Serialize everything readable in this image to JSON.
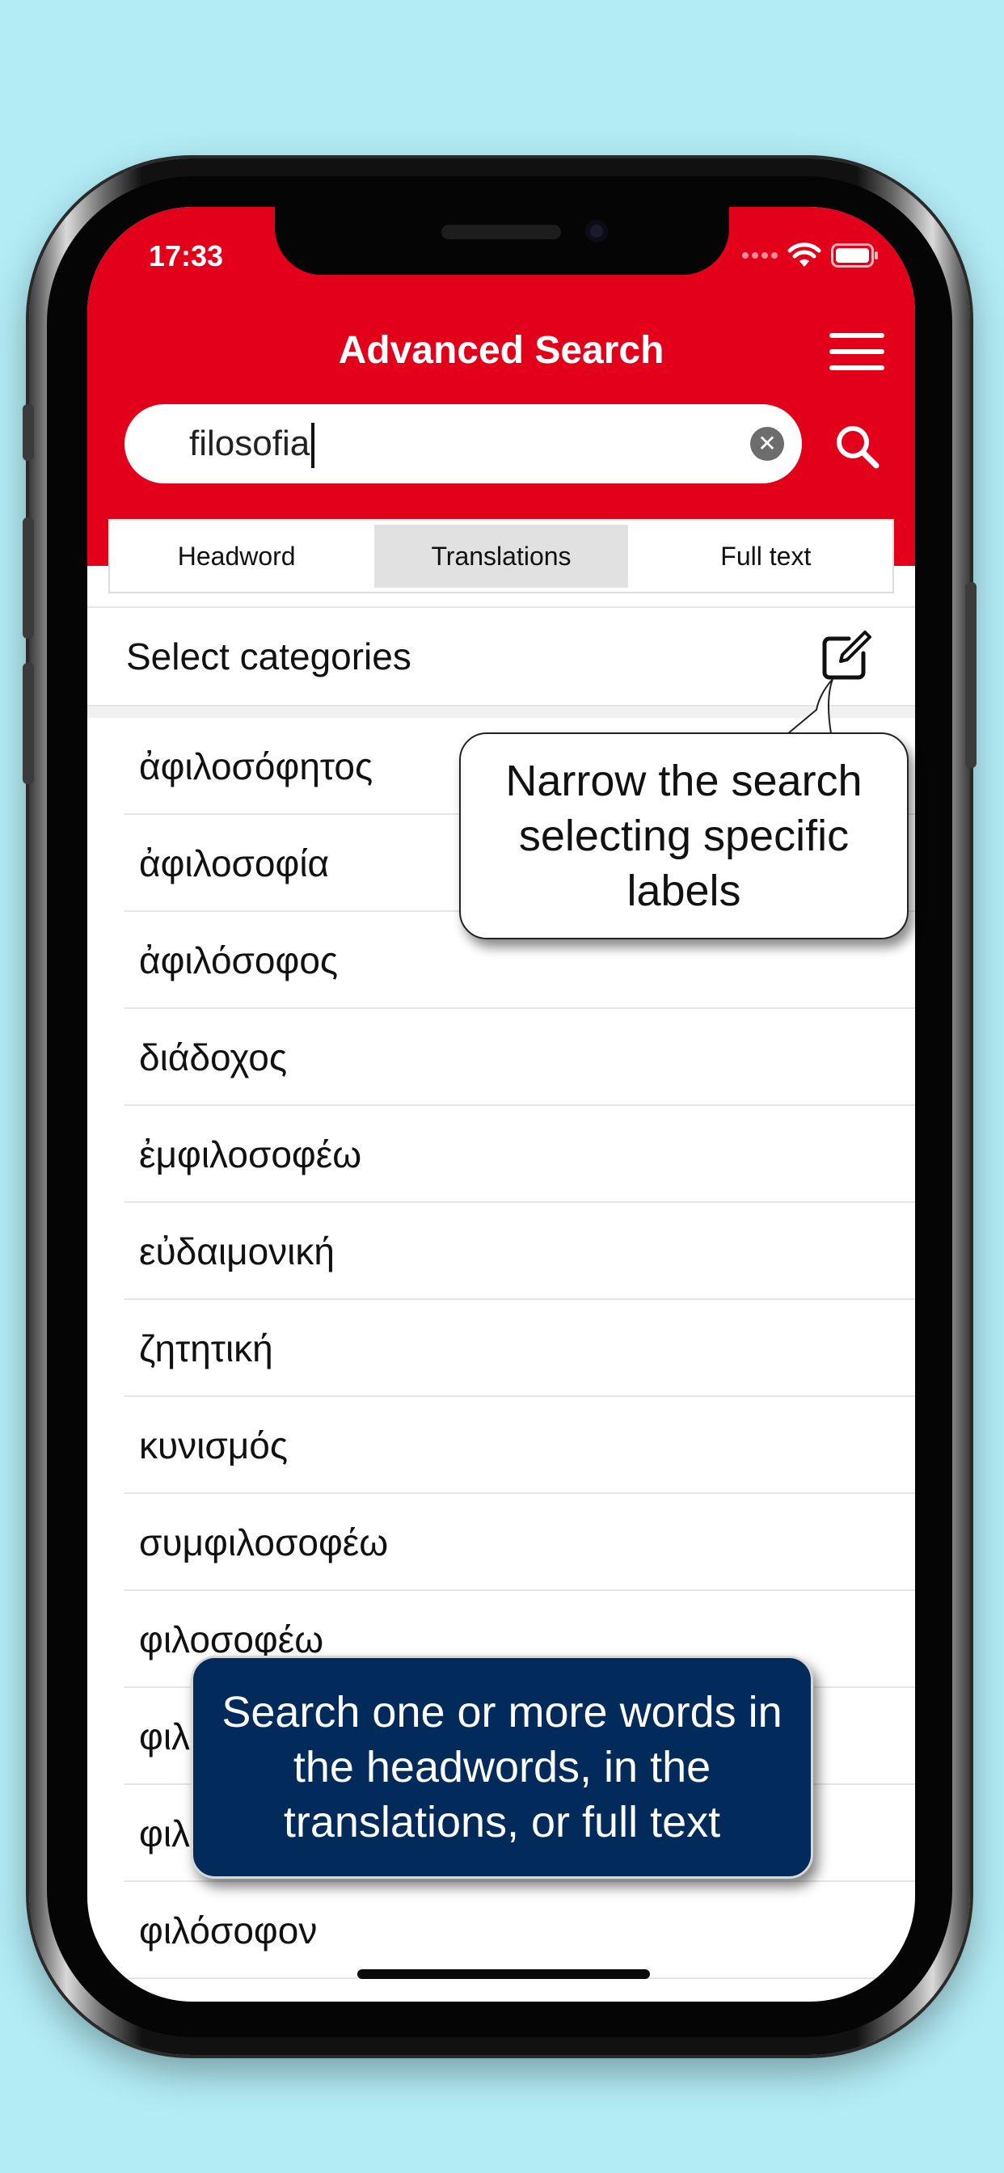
{
  "status_bar": {
    "time": "17:33"
  },
  "header": {
    "title": "Advanced Search"
  },
  "search": {
    "value": "filosofia"
  },
  "tabs": [
    {
      "label": "Headword",
      "active": false
    },
    {
      "label": "Translations",
      "active": true
    },
    {
      "label": "Full text",
      "active": false
    }
  ],
  "categories": {
    "label": "Select categories"
  },
  "results": [
    "ἀφιλοσόφητος",
    "ἀφιλοσοφία",
    "ἀφιλόσοφος",
    "διάδοχος",
    "ἐμφιλοσοφέω",
    "εὐδαιμονική",
    "ζητητική",
    "κυνισμός",
    "συμφιλοσοφέω",
    "φιλοσοφέω",
    "φιλ",
    "φιλ",
    "φιλόσοφον"
  ],
  "callouts": {
    "categories_hint": "Narrow the search selecting specific labels",
    "search_hint": "Search one or more words in the headwords, in the translations, or full text"
  },
  "colors": {
    "accent_red": "#e2001a",
    "callout_blue": "#022a5a",
    "background": "#b3ecf5"
  },
  "icons": [
    "wifi-icon",
    "battery-icon",
    "hamburger-icon",
    "clear-icon",
    "search-icon",
    "edit-icon"
  ]
}
